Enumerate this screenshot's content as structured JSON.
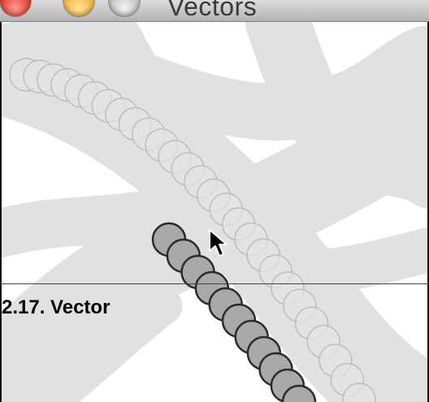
{
  "window": {
    "title": "Vectors"
  },
  "caption": {
    "text": "2.17.  Vector"
  },
  "colors": {
    "close_button": "#e0392b",
    "minimize_button": "#f2b23a",
    "zoom_button": "#bcbcbc",
    "trail_fill": "#e3e3e3",
    "mover_fill": "#a9a9a9",
    "background_stroke": "#e1e1e1"
  },
  "icons": {
    "cursor": "arrow-cursor-icon"
  }
}
